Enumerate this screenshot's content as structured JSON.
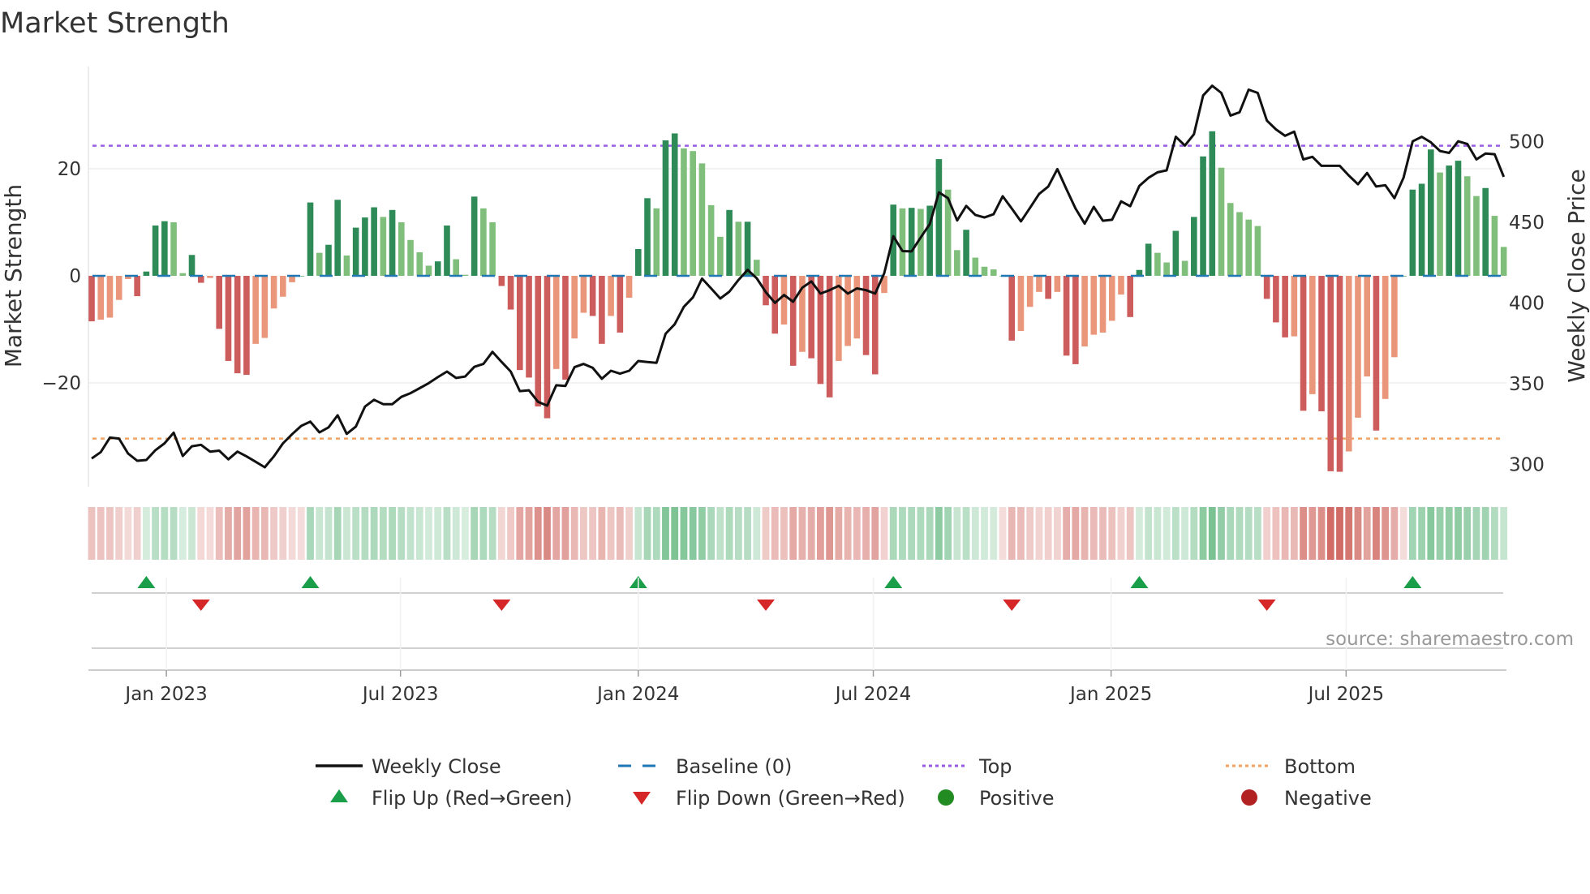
{
  "chart_data": {
    "type": "bar",
    "title": "Market Strength",
    "ylabel": "Market Strength",
    "y2label": "Weekly Close Price",
    "ylim": [
      -39,
      39
    ],
    "y2lim": [
      270,
      545
    ],
    "yticks": [
      20,
      0,
      -20
    ],
    "y2ticks": [
      500,
      450,
      400,
      350,
      300
    ],
    "xticks": [
      {
        "label": "Jan 2023",
        "week": 8.2
      },
      {
        "label": "Jul 2023",
        "week": 33.9
      },
      {
        "label": "Jan 2024",
        "week": 60.0
      },
      {
        "label": "Jul 2024",
        "week": 85.8
      },
      {
        "label": "Jan 2025",
        "week": 111.9
      },
      {
        "label": "Jul 2025",
        "week": 137.7
      }
    ],
    "top_level": 24.3,
    "bottom_level": -30.4,
    "baseline": 0,
    "strength": [
      -8.5,
      -8.2,
      -7.8,
      -4.5,
      -0.6,
      -3.8,
      0.8,
      9.4,
      10.2,
      10.0,
      0.5,
      3.9,
      -1.3,
      -0.4,
      -9.9,
      -15.9,
      -18.2,
      -18.5,
      -12.7,
      -11.6,
      -6.1,
      -3.9,
      -1.2,
      0,
      13.7,
      4.3,
      5.8,
      14.2,
      3.8,
      9.0,
      10.9,
      12.8,
      11.0,
      12.3,
      10.0,
      6.7,
      4.4,
      1.9,
      2.7,
      9.4,
      3.1,
      0.2,
      14.8,
      12.6,
      10.0,
      -1.9,
      -6.3,
      -17.6,
      -19,
      -24.4,
      -26.6,
      -17.4,
      -19.4,
      -11.7,
      -6.9,
      -7.5,
      -12.7,
      -7.5,
      -10.6,
      -4.1,
      5,
      14.5,
      12.6,
      25.3,
      26.6,
      23.8,
      23.3,
      21,
      13.2,
      7.3,
      12.3,
      10.1,
      10.1,
      3,
      -5.5,
      -10.8,
      -9.1,
      -16.8,
      -14.2,
      -15.4,
      -20.2,
      -22.7,
      -15.9,
      -13.1,
      -11.7,
      -14.8,
      -18.4,
      -3.2,
      13.3,
      12.6,
      12.7,
      12.5,
      13.1,
      21.8,
      16.1,
      4.8,
      8.6,
      3.4,
      1.7,
      1.2,
      0,
      -12.1,
      -10.3,
      -5.8,
      -3,
      -4.3,
      -3,
      -14.9,
      -16.5,
      -13.2,
      -11,
      -10.6,
      -8.4,
      -3.5,
      -7.7,
      1.1,
      6,
      4.3,
      2.5,
      8.4,
      2.8,
      11,
      22.3,
      27,
      20.2,
      13.6,
      11.9,
      10.5,
      9.3,
      -4.3,
      -8.7,
      -11.5,
      -11.3,
      -25.2,
      -22.1,
      -25.3,
      -36.5,
      -36.6,
      -32.8,
      -26.5,
      -18.8,
      -28.9,
      -23,
      -15.2,
      0,
      16.1,
      17.2,
      23.6,
      19.3,
      20.6,
      21.5,
      18.6,
      14.9,
      16.4,
      11.2,
      5.4
    ],
    "weekly_close": [
      303.7,
      307.7,
      316.7,
      316.1,
      306.8,
      302.3,
      302.8,
      308.9,
      313.1,
      319.7,
      305.3,
      311.3,
      312.2,
      308,
      308.6,
      303.2,
      308,
      305,
      301.7,
      298.3,
      305,
      313.1,
      318.8,
      323.9,
      326.6,
      319.9,
      323,
      330.5,
      319,
      323.5,
      335.9,
      340.1,
      337.4,
      337.4,
      341.9,
      344.2,
      347.3,
      350.4,
      354.1,
      357.6,
      353.6,
      354.5,
      360.5,
      362.3,
      369.8,
      363.5,
      357.6,
      345.5,
      346,
      338.8,
      336.5,
      349.1,
      348.7,
      360.3,
      362.3,
      359.9,
      353.1,
      358.1,
      356.3,
      358.1,
      364.1,
      363.5,
      363,
      381,
      386.9,
      397.7,
      403.5,
      415.2,
      409.1,
      402.8,
      407.1,
      414.3,
      420.6,
      415.4,
      406.8,
      400.1,
      405,
      400.8,
      409.5,
      413.4,
      405.9,
      408,
      410.7,
      405.9,
      409.1,
      408,
      405.9,
      418.5,
      441.4,
      432.2,
      432,
      440.6,
      449,
      468.6,
      465,
      451.2,
      460.2,
      454.6,
      453,
      455,
      466.2,
      458.6,
      450.6,
      459,
      467.6,
      472.2,
      483,
      470.6,
      458.6,
      449.2,
      459.6,
      451,
      451.6,
      463,
      460,
      472.6,
      477.6,
      481,
      482.2,
      503,
      497.6,
      504.6,
      528.6,
      534.6,
      530.2,
      516.2,
      518.2,
      532.2,
      530.2,
      513,
      507.6,
      503.6,
      506.2,
      489,
      490.6,
      485,
      485,
      485,
      479,
      473.6,
      480.6,
      472.2,
      473,
      465,
      477.6,
      500.2,
      503,
      499.6,
      494.2,
      493,
      500.2,
      498.6,
      489,
      492.6,
      492.2,
      478.2
    ],
    "legend": {
      "placement": "bottom",
      "items": [
        {
          "key": "weekly_close",
          "label": "Weekly Close"
        },
        {
          "key": "baseline",
          "label": "Baseline (0)"
        },
        {
          "key": "top",
          "label": "Top"
        },
        {
          "key": "bottom",
          "label": "Bottom"
        },
        {
          "key": "flip_up",
          "label": "Flip Up (Red→Green)"
        },
        {
          "key": "flip_down",
          "label": "Flip Down (Green→Red)"
        },
        {
          "key": "positive",
          "label": "Positive"
        },
        {
          "key": "negative",
          "label": "Negative"
        }
      ]
    },
    "source": "source: sharemaestro.com"
  },
  "colors": {
    "pos_strong": "#2e8b57",
    "pos_weak": "#7fbf7b",
    "neg_strong": "#cd5c5c",
    "neg_weak": "#e9967a",
    "line": "#111111",
    "baseline": "#1f77b4",
    "top": "#9b5de5",
    "bottom": "#f4a261",
    "flip_up": "#1a9e4a",
    "flip_down": "#d62728",
    "positive": "#228b22",
    "negative": "#b22222"
  }
}
